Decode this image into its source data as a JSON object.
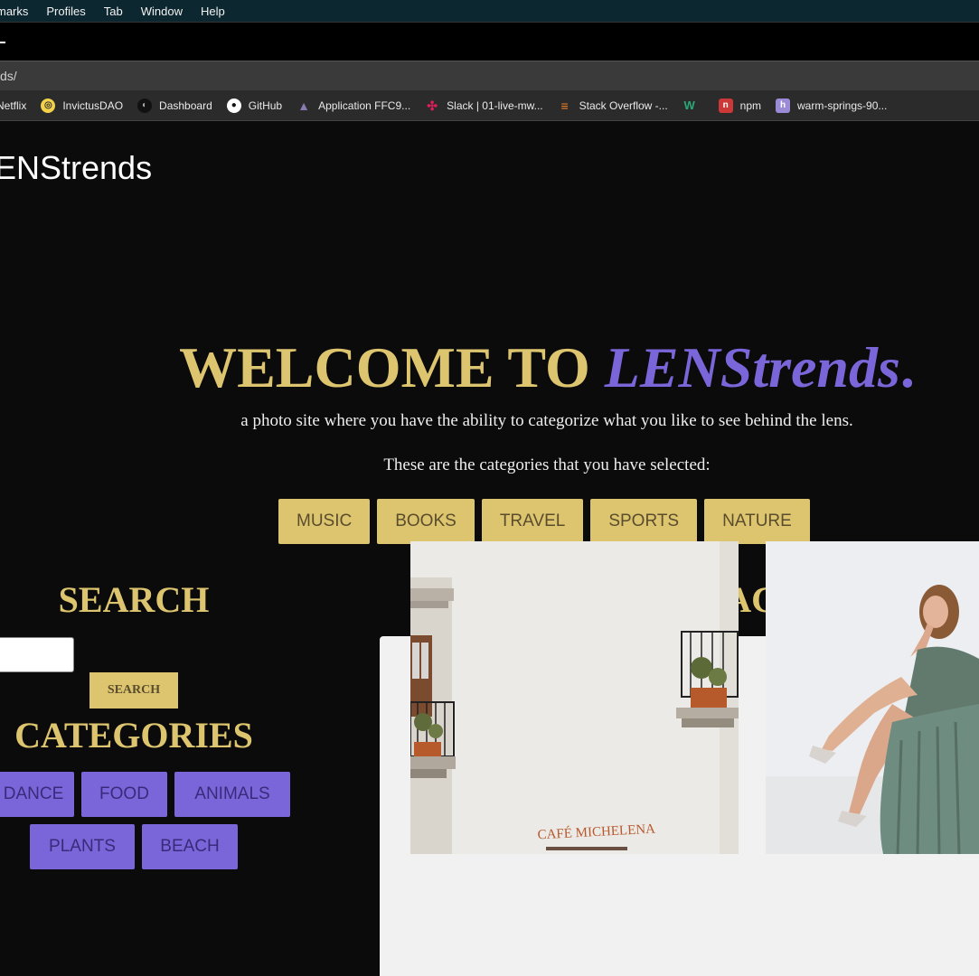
{
  "menubar": {
    "items": [
      "marks",
      "Profiles",
      "Tab",
      "Window",
      "Help"
    ]
  },
  "addressbar": {
    "url": "ds/"
  },
  "bookmarks": [
    {
      "label": "Netflix",
      "icon": "netflix-icon"
    },
    {
      "label": "InvictusDAO",
      "icon": "invictusdao-icon"
    },
    {
      "label": "Dashboard",
      "icon": "dashboard-icon"
    },
    {
      "label": "GitHub",
      "icon": "github-icon"
    },
    {
      "label": "Application FFC9...",
      "icon": "application-icon"
    },
    {
      "label": "Slack | 01-live-mw...",
      "icon": "slack-icon"
    },
    {
      "label": "Stack Overflow -...",
      "icon": "stackoverflow-icon"
    },
    {
      "label": "",
      "icon": "w-icon"
    },
    {
      "label": "npm",
      "icon": "npm-icon"
    },
    {
      "label": "warm-springs-90...",
      "icon": "heroku-icon"
    }
  ],
  "brand": "ENStrends",
  "hero": {
    "title_prefix": "WELCOME TO ",
    "title_accent": "LENStrends",
    "title_dot": ".",
    "tagline": "a photo site where you have the ability to categorize what you like to see behind the lens.",
    "selected_note": "These are the categories that you have selected:"
  },
  "selected_categories": [
    "MUSIC",
    "BOOKS",
    "TRAVEL",
    "SPORTS",
    "NATURE"
  ],
  "search": {
    "heading": "SEARCH",
    "placeholder": "",
    "button_label": "SEARCH"
  },
  "categories": {
    "heading": "CATEGORIES",
    "items": [
      "DANCE",
      "FOOD",
      "ANIMALS",
      "PLANTS",
      "BEACH"
    ]
  },
  "images": {
    "heading": "IMAGES",
    "cafe_sign": "CAFÉ MICHELENA"
  },
  "colors": {
    "gold": "#ddc56f",
    "purple": "#7b66d9",
    "background": "#0b0b0b"
  }
}
